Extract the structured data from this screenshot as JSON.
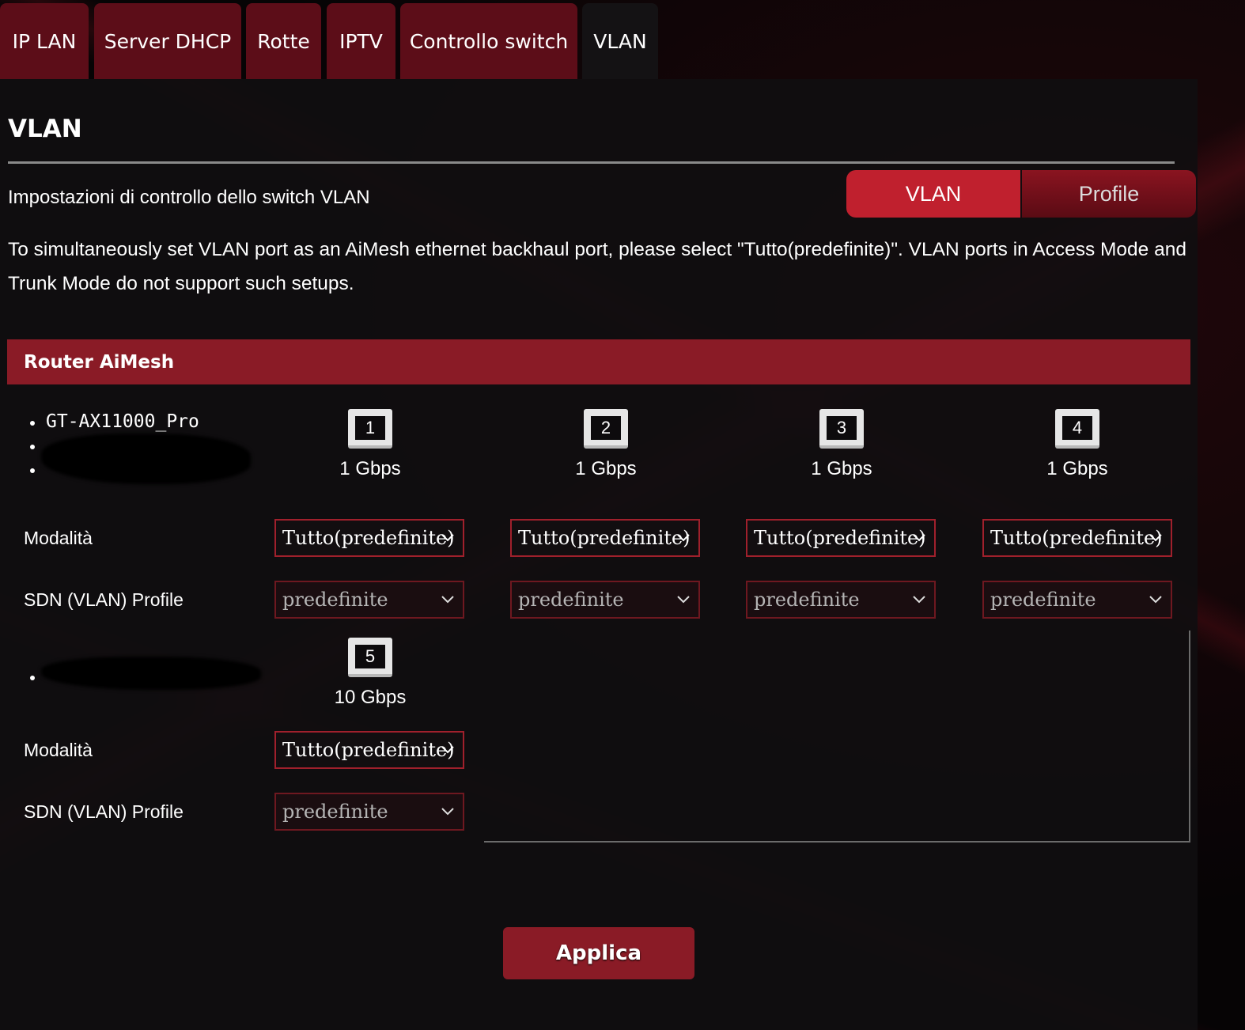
{
  "tabs": [
    {
      "label": "IP LAN"
    },
    {
      "label": "Server DHCP"
    },
    {
      "label": "Rotte"
    },
    {
      "label": "IPTV"
    },
    {
      "label": "Controllo switch"
    },
    {
      "label": "VLAN"
    }
  ],
  "page": {
    "title": "VLAN",
    "subtitle": "Impostazioni di controllo dello switch VLAN",
    "toggle": {
      "vlan_label": "VLAN",
      "profile_label": "Profile"
    },
    "notice": "To simultaneously set VLAN port as an AiMesh ethernet backhaul port, please select \"Tutto(predefinite)\". VLAN ports in Access Mode and Trunk Mode do not support such setups."
  },
  "section": {
    "title": "Router AiMesh",
    "device_name": "GT-AX11000_Pro",
    "mode_label": "Modalità",
    "profile_label": "SDN (VLAN) Profile",
    "ports": [
      {
        "number": "1",
        "speed": "1 Gbps",
        "mode": "Tutto(predefinite)",
        "profile": "predefinite"
      },
      {
        "number": "2",
        "speed": "1 Gbps",
        "mode": "Tutto(predefinite)",
        "profile": "predefinite"
      },
      {
        "number": "3",
        "speed": "1 Gbps",
        "mode": "Tutto(predefinite)",
        "profile": "predefinite"
      },
      {
        "number": "4",
        "speed": "1 Gbps",
        "mode": "Tutto(predefinite)",
        "profile": "predefinite"
      },
      {
        "number": "5",
        "speed": "10 Gbps",
        "mode": "Tutto(predefinite)",
        "profile": "predefinite"
      }
    ]
  },
  "actions": {
    "apply_label": "Applica"
  },
  "colors": {
    "accent": "#8a1b26",
    "tab": "#5c0d18",
    "toggle_active": "#c0202e"
  }
}
